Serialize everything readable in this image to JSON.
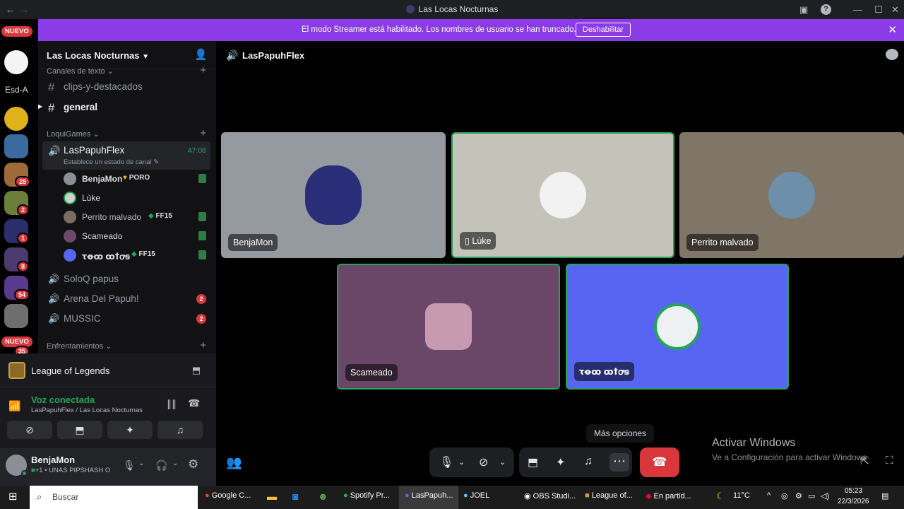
{
  "window": {
    "title": "Las Locas Nocturnas"
  },
  "banner": {
    "message": "El modo Streamer está habilitado. Los nombres de usuario se han truncado.",
    "button": "Deshabilitar"
  },
  "rail": {
    "nuevo_top": "NUEVO",
    "server_text": "Esd-A",
    "badges": [
      "28",
      "2",
      "1",
      "8",
      "54",
      "35"
    ],
    "nuevo_bottom": "NUEVO"
  },
  "server": {
    "name": "Las Locas Nocturnas"
  },
  "channels": {
    "cat_text": "Canales de texto",
    "text1": "clips-y-destacados",
    "text2": "general",
    "cat_loqui": "LoquiGames",
    "voice_active": "LasPapuhFlex",
    "voice_timer": "47:08",
    "voice_status": "Establece un estado de canal",
    "voice2": "SoloQ papus",
    "voice3": "Arena Del Papuh!",
    "voice3_badge": "2",
    "voice4": "MUSSIC",
    "voice4_badge": "2",
    "cat_enf": "Enfrentamientos"
  },
  "members": [
    {
      "name": "BenjaMon",
      "tag": "PORO"
    },
    {
      "name": "Lùke",
      "tag": ""
    },
    {
      "name": "Perrito malvado",
      "tag": "FF15"
    },
    {
      "name": "Scameado",
      "tag": ""
    },
    {
      "name": "ꚍꝋꝏ ꝏꝉꝍꞩ",
      "tag": "FF15"
    }
  ],
  "activity": {
    "game": "League of Legends"
  },
  "voice": {
    "status": "Voz conectada",
    "location": "LasPapuhFlex / Las Locas Nocturnas"
  },
  "current_user": {
    "name": "BenjaMon",
    "status": "+1 • UNAS PIPSHASH O"
  },
  "main": {
    "channel_title": "LasPapuhFlex",
    "tiles": [
      "BenjaMon",
      "Lùke",
      "Perrito malvado",
      "Scameado",
      "ꚍꝋꝏ ꝏꝉꝍꞩ"
    ],
    "tooltip": "Más opciones"
  },
  "watermark": {
    "line1": "Activar Windows",
    "line2": "Ve a Configuración para activar Windows."
  },
  "taskbar": {
    "search": "Buscar",
    "apps": [
      "Google C...",
      "Spotify Pr...",
      "LasPapuh...",
      "JOEL",
      "OBS Studi...",
      "League of...",
      "En partid..."
    ],
    "temp": "11°C",
    "time": "05:23",
    "date": "22/3/2026"
  },
  "colors": {
    "accent": "#8c3ce6",
    "connected": "#23a55a",
    "danger": "#da373c",
    "blurple": "#5865f2"
  }
}
